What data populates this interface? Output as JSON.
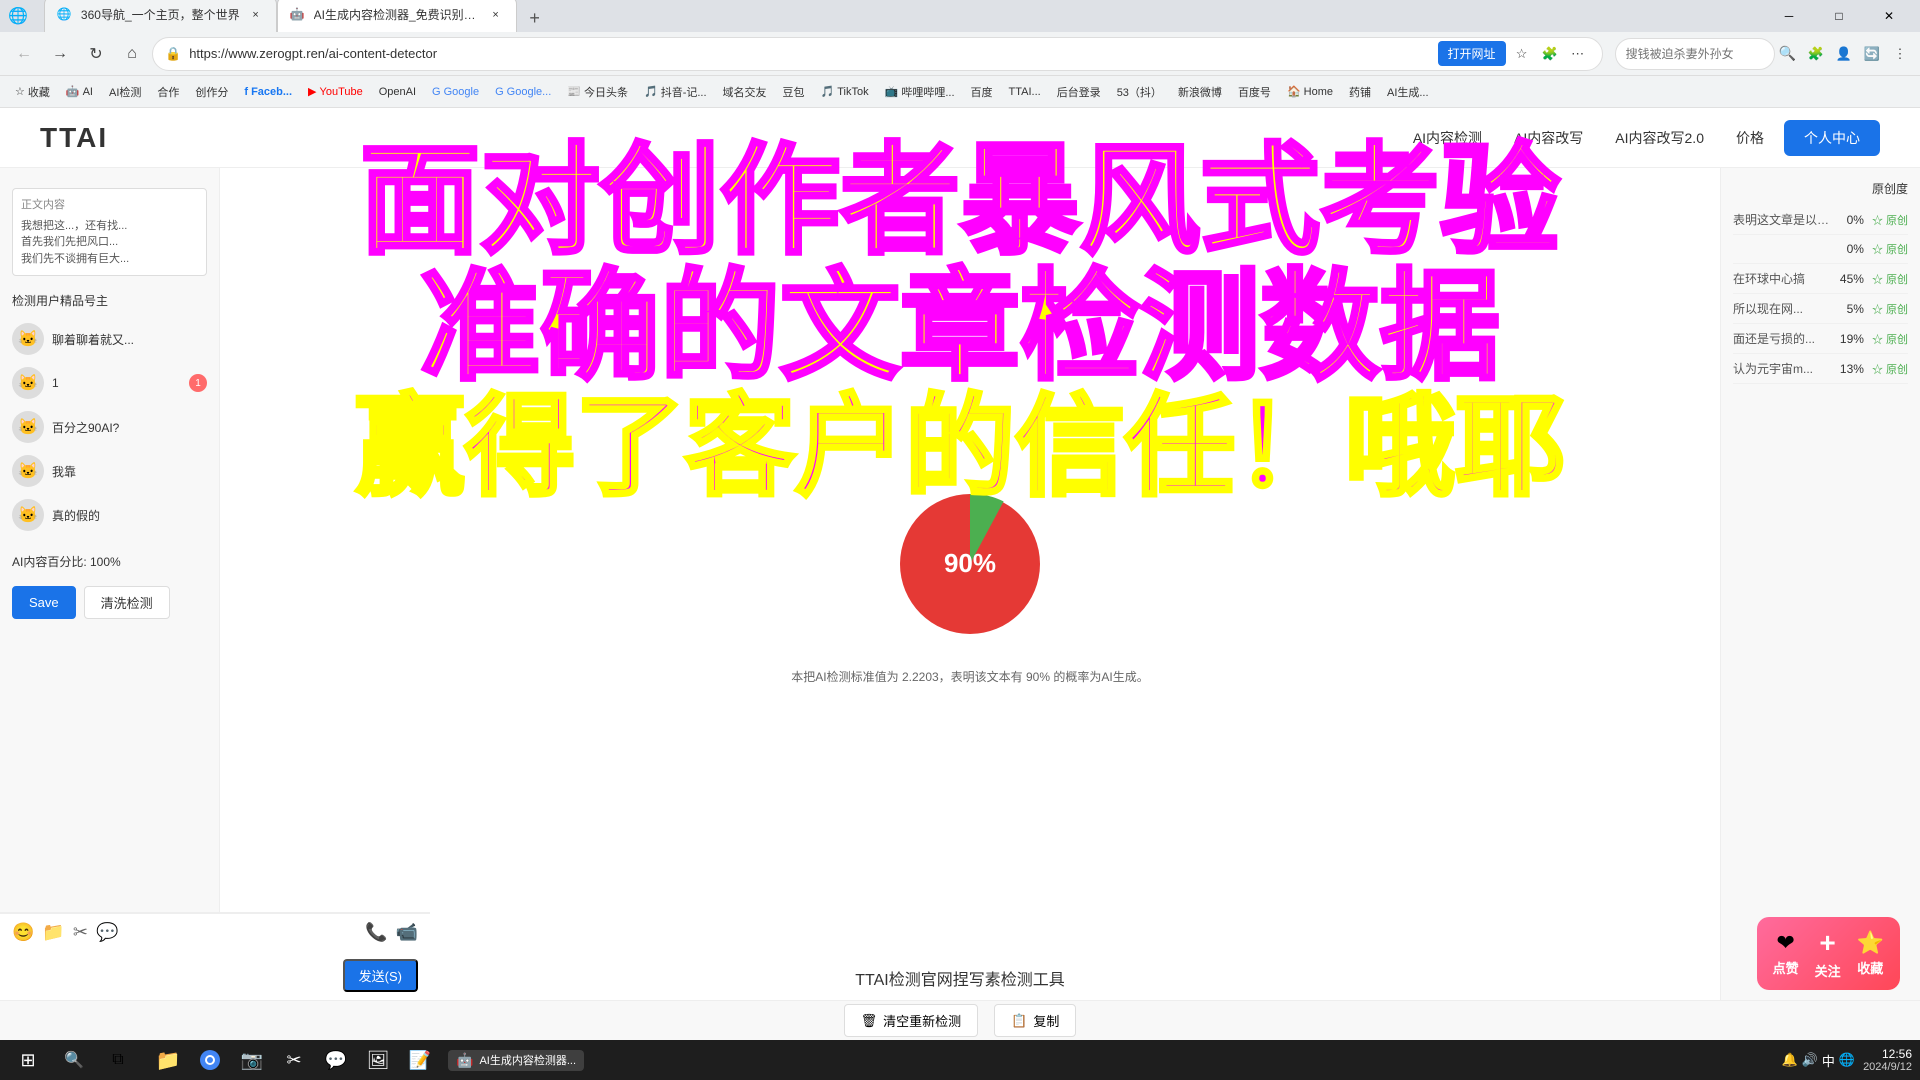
{
  "browser": {
    "tabs": [
      {
        "id": "tab1",
        "title": "360导航_一个主页，整个世界",
        "favicon": "🌐",
        "active": false
      },
      {
        "id": "tab2",
        "title": "AI生成内容检测器_免费识别AI...",
        "favicon": "🤖",
        "active": true
      }
    ],
    "new_tab_label": "+",
    "address": "https://www.zerogpt.ren/ai-content-detector",
    "open_btn_label": "打开网址",
    "search_placeholder": "搜钱被迫杀妻外孙女",
    "nav": {
      "back": "←",
      "forward": "→",
      "refresh": "↻",
      "home": "⌂"
    }
  },
  "bookmarks": [
    {
      "label": "收藏",
      "icon": "☆"
    },
    {
      "label": "AI",
      "icon": "🤖"
    },
    {
      "label": "AI检测",
      "icon": ""
    },
    {
      "label": "合作",
      "icon": ""
    },
    {
      "label": "创作分",
      "icon": ""
    },
    {
      "label": "Faceb...",
      "icon": "f"
    },
    {
      "label": "YouTube",
      "icon": "▶"
    },
    {
      "label": "OpenAI",
      "icon": ""
    },
    {
      "label": "Google",
      "icon": "G"
    },
    {
      "label": "Google...",
      "icon": "G"
    },
    {
      "label": "今日头条",
      "icon": ""
    },
    {
      "label": "抖音-记...",
      "icon": ""
    },
    {
      "label": "域名交友",
      "icon": ""
    },
    {
      "label": "豆包",
      "icon": ""
    },
    {
      "label": "TikTok",
      "icon": ""
    },
    {
      "label": "哔哩哔哩...",
      "icon": ""
    },
    {
      "label": "百度",
      "icon": ""
    },
    {
      "label": "TTAI...",
      "icon": ""
    },
    {
      "label": "后台登录",
      "icon": ""
    },
    {
      "label": "53（抖）",
      "icon": ""
    },
    {
      "label": "新浪微博",
      "icon": ""
    },
    {
      "label": "百度号",
      "icon": ""
    },
    {
      "label": "Home",
      "icon": "🏠"
    },
    {
      "label": "药铺",
      "icon": ""
    },
    {
      "label": "AI生成...",
      "icon": ""
    }
  ],
  "site": {
    "logo": "TTAI",
    "nav_items": [
      "AI内容检测",
      "AI内容改写",
      "AI内容改写2.0",
      "价格"
    ],
    "personal_btn": "个人中心"
  },
  "sidebar": {
    "label": "正文内容",
    "preview_lines": [
      "正文内容",
      "我想把这...，还有找...",
      "首先我们先把风口...",
      "我们先不谈拥有巨大..."
    ],
    "detect_users_title": "检测用户精品号主",
    "users": [
      {
        "name": "聊着聊着就又...",
        "avatar": "🐱"
      },
      {
        "name": "1",
        "avatar": "🐱",
        "badge": "1"
      },
      {
        "name": "百分之90AI?",
        "avatar": "🐱"
      },
      {
        "name": "我靠",
        "avatar": "🐱"
      },
      {
        "name": "真的假的",
        "avatar": "🐱"
      }
    ]
  },
  "detection": {
    "result_texts": [
      "...表明这文章是以自己本行，...",
      "...",
      "...在环球中心搞...",
      "...所以现在网...",
      "...面还是亏损的...",
      "...认为元宇宙m..."
    ],
    "result_percentages": [
      "0%",
      "0%",
      "45%",
      "5%",
      "19%",
      "13%"
    ],
    "result_badges": [
      "☆ 原创",
      "☆ 原创",
      "☆ 原创",
      "☆ 原创",
      "☆ 原创",
      "☆ 原创"
    ],
    "right_panel_title": "原创度",
    "chart_percent": "90%",
    "chart_caption": "本把AI检测标准值为 2.2203，表明该文本有 90% 的概率为AI生成。",
    "ai_percent_label": "AI内容百分比: 100%",
    "btn_submit": "Save",
    "btn_clear": "清洗检测",
    "bottom_clear_btn": "清空重新检测",
    "bottom_copy_btn": "复制",
    "bottom_label": "TTAI检测官网捏写素检测工具"
  },
  "overlay": {
    "line1": "面对创作者暴风式考验",
    "line2": "准确的文章检测数据",
    "line3": "赢得了客户的信任！哦耶"
  },
  "chat": {
    "input_placeholder": "",
    "send_label": "发送(S)"
  },
  "taskbar": {
    "time": "12:56",
    "date": "2024/9/12",
    "apps": [
      {
        "name": "start",
        "icon": "⊞"
      },
      {
        "name": "search",
        "icon": "🔍"
      },
      {
        "name": "task-view",
        "icon": "⧉"
      },
      {
        "name": "file-explorer",
        "icon": "📁"
      },
      {
        "name": "chrome",
        "icon": "●"
      },
      {
        "name": "captura",
        "icon": "📷"
      },
      {
        "name": "editor",
        "icon": "✂"
      },
      {
        "name": "wechat",
        "icon": "💬"
      },
      {
        "name": "photo-viewer",
        "icon": "🖼"
      },
      {
        "name": "notes",
        "icon": "📝"
      }
    ],
    "tray_icons": [
      "🔔",
      "🔊",
      "中",
      "🌐"
    ],
    "active_app": "AI生成内容检测器..."
  },
  "interaction_widget": {
    "like_icon": "❤",
    "like_label": "点赞",
    "follow_icon": "+",
    "follow_label": "关注",
    "collect_icon": "⭐",
    "collect_label": "收藏"
  }
}
